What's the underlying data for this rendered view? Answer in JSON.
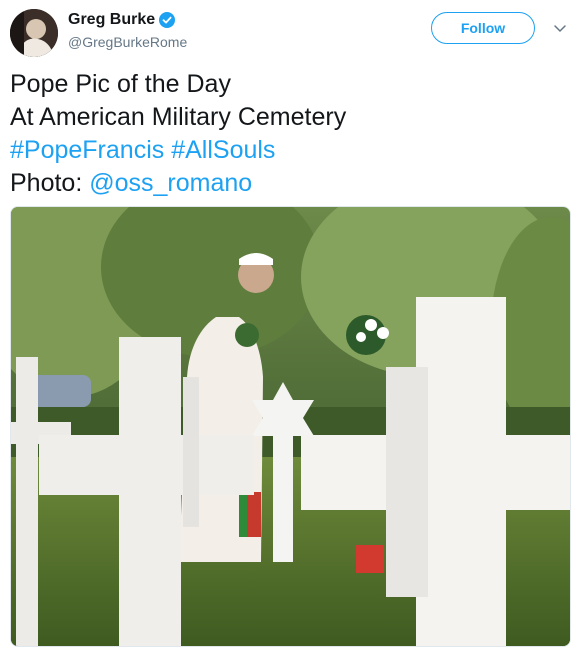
{
  "user": {
    "display_name": "Greg Burke",
    "handle": "@GregBurkeRome",
    "verified": true,
    "avatar_icon": "avatar-portrait"
  },
  "actions": {
    "follow_label": "Follow",
    "menu_icon": "chevron-down-icon"
  },
  "tweet": {
    "line1": "Pope Pic of the Day",
    "line2": "At American Military Cemetery",
    "hashtag1": "#PopeFrancis",
    "hashtag2": "#AllSouls",
    "photo_prefix": "Photo: ",
    "mention": "@oss_romano"
  },
  "colors": {
    "accent": "#1da1f2",
    "text": "#14171a",
    "muted": "#657786"
  }
}
